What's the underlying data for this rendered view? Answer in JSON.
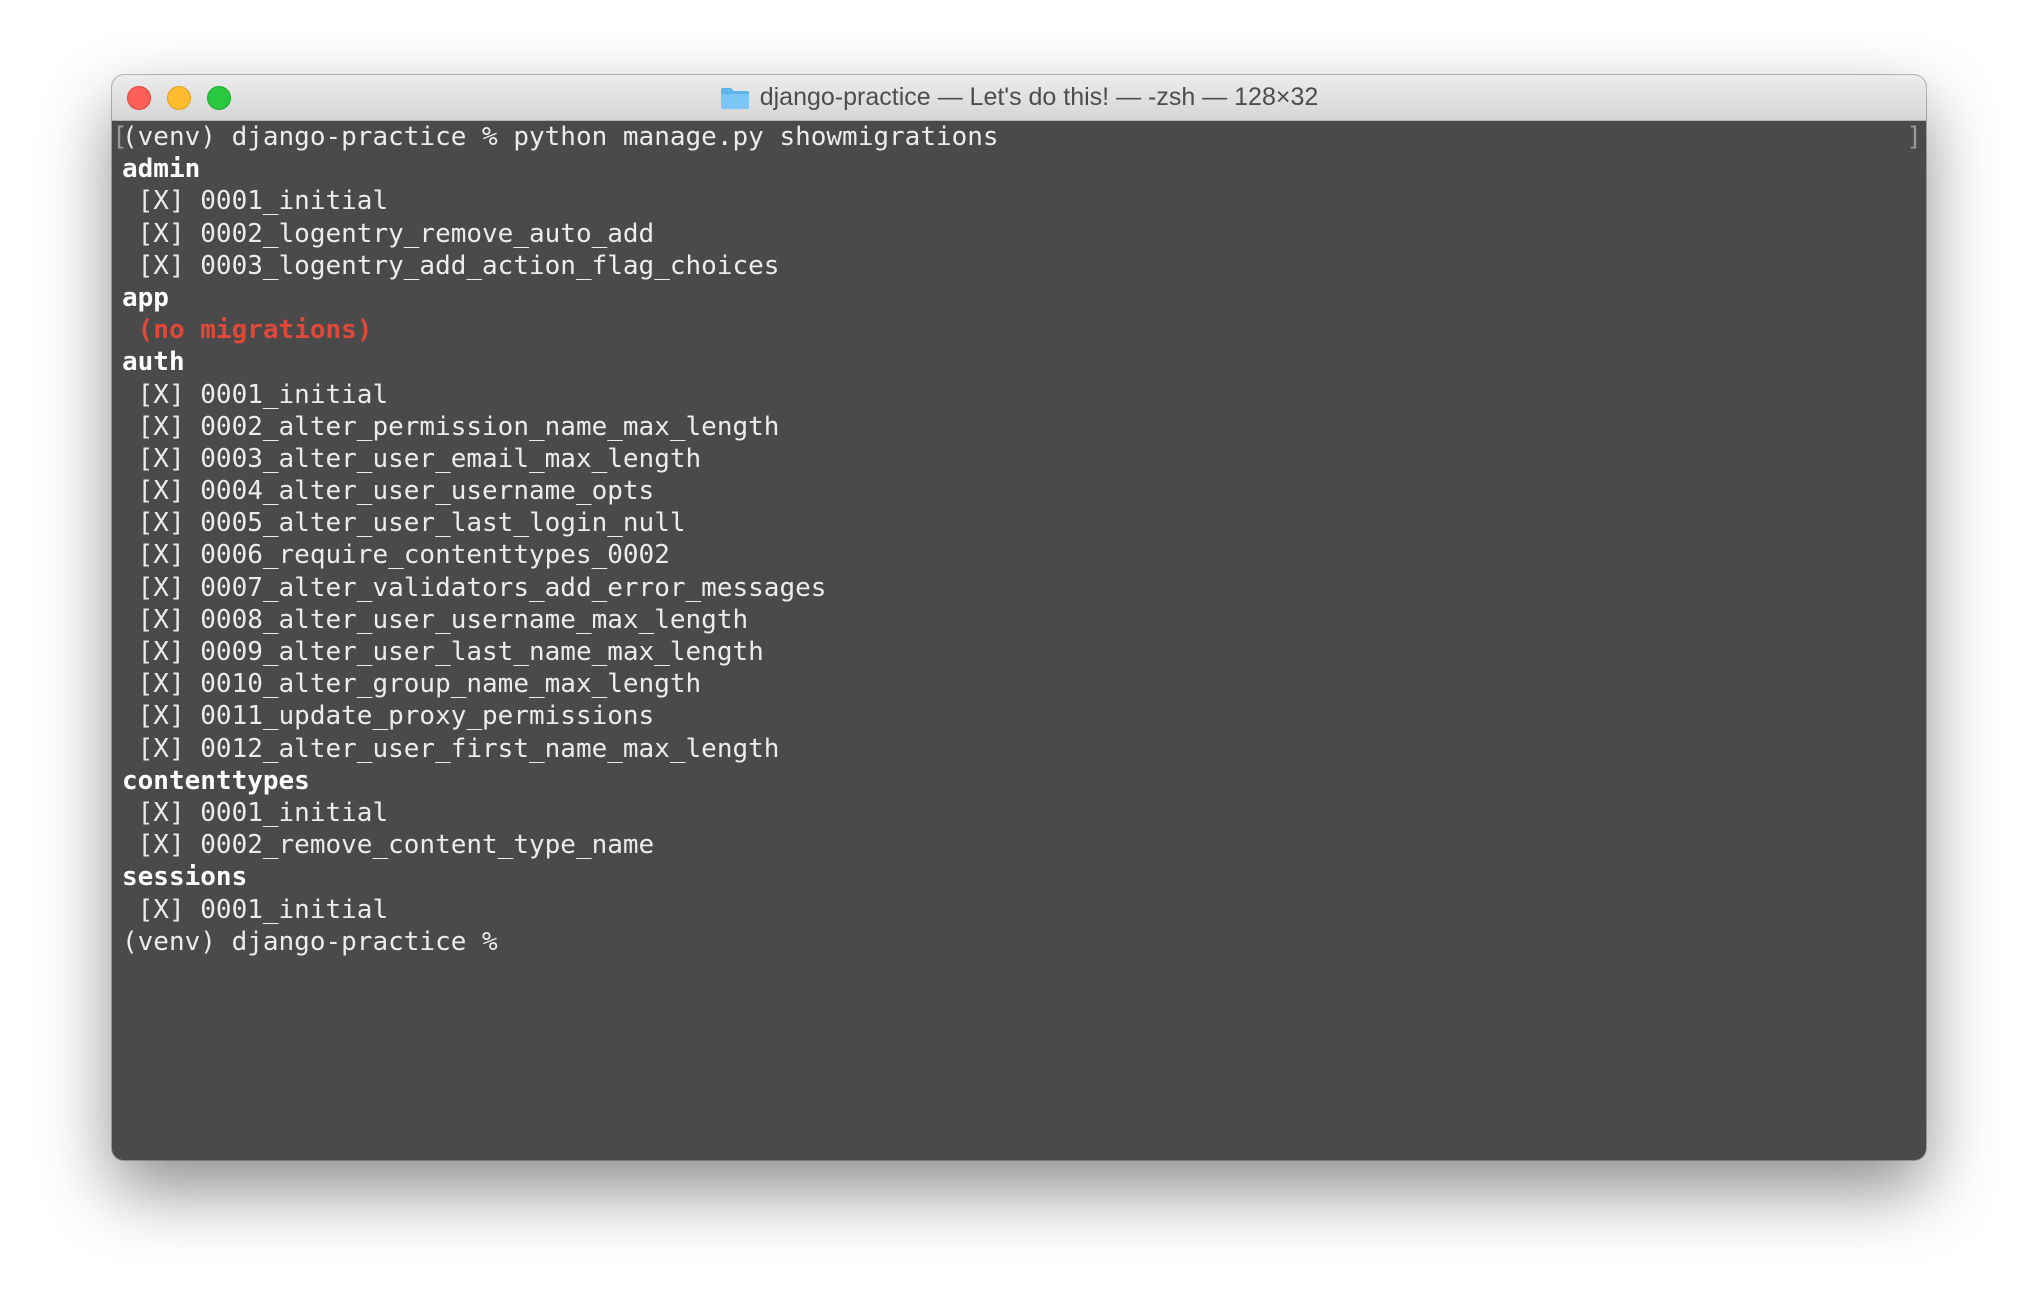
{
  "window": {
    "title": "django-practice — Let's do this! — -zsh — 128×32",
    "icon": "folder-icon",
    "colors": {
      "terminal_bg": "#4a4a4a",
      "text": "#ececec",
      "error": "#e0483a",
      "close": "#fe5f57",
      "minimize": "#febc2e",
      "maximize": "#28c840"
    }
  },
  "terminal": {
    "bracket_left": "[",
    "bracket_right": "]",
    "lines": [
      {
        "text": "(venv) django-practice % python manage.py showmigrations",
        "style": "normal"
      },
      {
        "text": "admin",
        "style": "bold"
      },
      {
        "text": " [X] 0001_initial",
        "style": "normal"
      },
      {
        "text": " [X] 0002_logentry_remove_auto_add",
        "style": "normal"
      },
      {
        "text": " [X] 0003_logentry_add_action_flag_choices",
        "style": "normal"
      },
      {
        "text": "app",
        "style": "bold"
      },
      {
        "text": " (no migrations)",
        "style": "error"
      },
      {
        "text": "auth",
        "style": "bold"
      },
      {
        "text": " [X] 0001_initial",
        "style": "normal"
      },
      {
        "text": " [X] 0002_alter_permission_name_max_length",
        "style": "normal"
      },
      {
        "text": " [X] 0003_alter_user_email_max_length",
        "style": "normal"
      },
      {
        "text": " [X] 0004_alter_user_username_opts",
        "style": "normal"
      },
      {
        "text": " [X] 0005_alter_user_last_login_null",
        "style": "normal"
      },
      {
        "text": " [X] 0006_require_contenttypes_0002",
        "style": "normal"
      },
      {
        "text": " [X] 0007_alter_validators_add_error_messages",
        "style": "normal"
      },
      {
        "text": " [X] 0008_alter_user_username_max_length",
        "style": "normal"
      },
      {
        "text": " [X] 0009_alter_user_last_name_max_length",
        "style": "normal"
      },
      {
        "text": " [X] 0010_alter_group_name_max_length",
        "style": "normal"
      },
      {
        "text": " [X] 0011_update_proxy_permissions",
        "style": "normal"
      },
      {
        "text": " [X] 0012_alter_user_first_name_max_length",
        "style": "normal"
      },
      {
        "text": "contenttypes",
        "style": "bold"
      },
      {
        "text": " [X] 0001_initial",
        "style": "normal"
      },
      {
        "text": " [X] 0002_remove_content_type_name",
        "style": "normal"
      },
      {
        "text": "sessions",
        "style": "bold"
      },
      {
        "text": " [X] 0001_initial",
        "style": "normal"
      },
      {
        "text": "(venv) django-practice % ",
        "style": "normal"
      }
    ]
  }
}
